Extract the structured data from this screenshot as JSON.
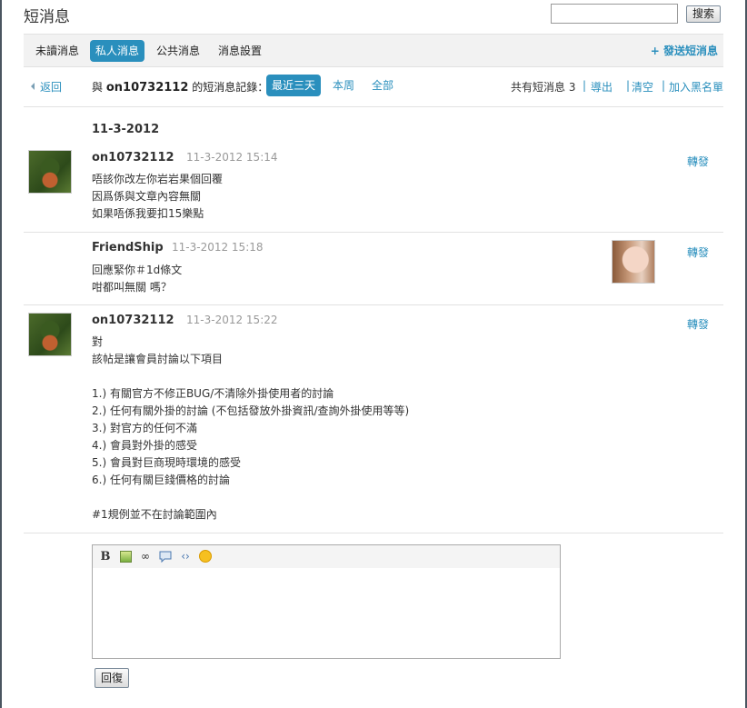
{
  "header": {
    "title": "短消息",
    "search_placeholder": "",
    "search_button": "搜索"
  },
  "tabs": [
    {
      "label": "未讀消息",
      "active": false
    },
    {
      "label": "私人消息",
      "active": true
    },
    {
      "label": "公共消息",
      "active": false
    },
    {
      "label": "消息設置",
      "active": false
    }
  ],
  "send_label": "+ 發送短消息",
  "infobar": {
    "back_label": "返回",
    "with_prefix": "與",
    "with_user": "on10732112",
    "with_suffix": "的短消息記錄：",
    "ranges": [
      {
        "label": "最近三天",
        "active": true
      },
      {
        "label": "本周",
        "active": false
      },
      {
        "label": "全部",
        "active": false
      }
    ],
    "count_label": "共有短消息",
    "count": "3",
    "actions": [
      "導出",
      "清空",
      "加入黑名單"
    ]
  },
  "date_heading": "11-3-2012",
  "messages": [
    {
      "author": "on10732112",
      "time": "11-3-2012 15:14",
      "forward": "轉發",
      "lines": [
        "唔該你改左你岩岩果個回覆",
        "因爲係與文章內容無關",
        "如果唔係我要扣15樂點"
      ]
    },
    {
      "author": "FriendShip",
      "time": "11-3-2012 15:18",
      "forward": "轉發",
      "lines": [
        "回應緊你＃1d條文",
        "咁都叫無關 嗎？"
      ]
    },
    {
      "author": "on10732112",
      "time": "11-3-2012 15:22",
      "forward": "轉發",
      "lines": [
        "對",
        "該帖是讓會員討論以下項目",
        "",
        "1.) 有關官方不修正BUG/不清除外掛使用者的討論",
        "2.) 任何有關外掛的討論 (不包括發放外掛資訊/查詢外掛使用等等)",
        "3.) 對官方的任何不滿",
        "4.) 會員對外掛的感受",
        "5.) 會員對巨商現時環境的感受",
        "6.) 任何有關巨錢價格的討論",
        "",
        "#1規例並不在討論範圍內"
      ]
    }
  ],
  "editor": {
    "toolbar_icons": [
      "bold-icon",
      "image-icon",
      "link-icon",
      "quote-icon",
      "code-icon",
      "smiley-icon"
    ],
    "bold_glyph": "B",
    "link_glyph": "∞",
    "code_glyph": "‹›",
    "content": ""
  },
  "reply_label": "回復",
  "colors": {
    "accent": "#2a8fbd",
    "tabbar_bg": "#f2f2f2",
    "muted": "#999999"
  }
}
